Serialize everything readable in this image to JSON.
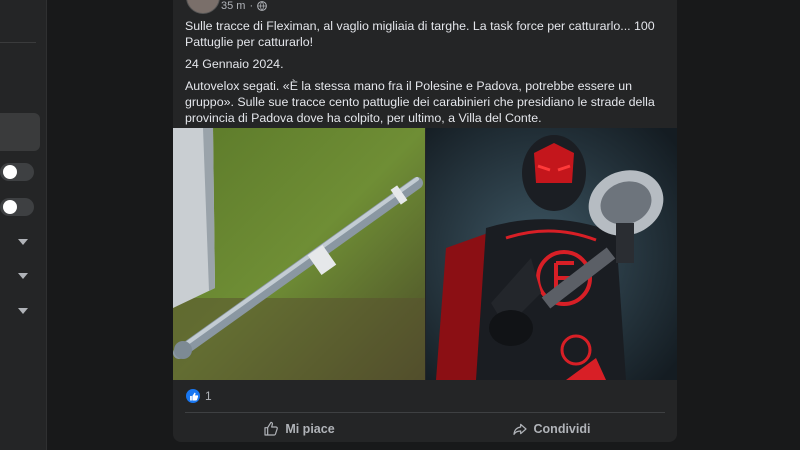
{
  "post": {
    "timestamp": "35 m",
    "paragraphs": [
      "Sulle tracce di Fleximan, al vaglio migliaia di targhe. La task force per catturarlo...  100 Pattuglie per catturarlo!",
      "24 Gennaio 2024.",
      "Autovelox segati. «È la stessa mano fra il Polesine e Padova, potrebbe essere un gruppo». Sulle sue tracce cento pattuglie dei carabinieri che presidiano le strade della provincia di Padova dove ha colpito, per ultimo, a Villa del Conte."
    ],
    "reaction_count": "1",
    "actions": {
      "like_label": "Mi piace",
      "share_label": "Condividi"
    }
  },
  "colors": {
    "background": "#18191a",
    "card": "#242526",
    "like_blue": "#1877f2",
    "accent_red": "#d81f26"
  },
  "icons": [
    "globe-icon",
    "like-bubble-icon",
    "thumbs-up-icon",
    "share-icon",
    "chevron-down-icon"
  ]
}
